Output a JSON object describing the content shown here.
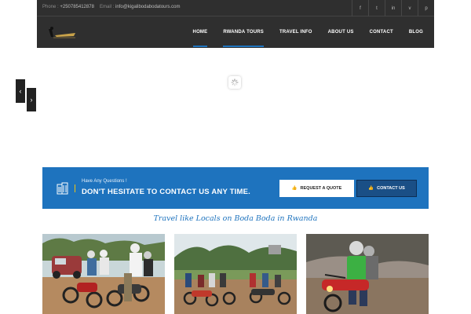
{
  "topbar": {
    "phone_label": "Phone :",
    "phone_value": "+250785412878",
    "email_label": "Email :",
    "email_value": "info@kigalibodabodatours.com",
    "social_icons": [
      "facebook-icon",
      "twitter-icon",
      "linkedin-icon",
      "vimeo-icon",
      "pinterest-icon"
    ],
    "social_glyphs": [
      "f",
      "t",
      "in",
      "v",
      "p"
    ]
  },
  "nav": {
    "items": [
      "HOME",
      "RWANDA TOURS",
      "TRAVEL INFO",
      "ABOUT US",
      "CONTACT",
      "BLOG"
    ]
  },
  "slider": {
    "prev_glyph": "‹",
    "next_glyph": "›"
  },
  "banner": {
    "question": "Have Any Questions !",
    "headline": "DON'T HESITATE TO CONTACT US ANY TIME.",
    "request_label": "REQUEST A QUOTE",
    "contact_label": "CONTACT US"
  },
  "tagline": "Travel like Locals on Boda Boda in Rwanda",
  "colors": {
    "accent_blue": "#1e73be",
    "header_dark": "#2f2f2f",
    "button_dark": "#1a4f86"
  }
}
